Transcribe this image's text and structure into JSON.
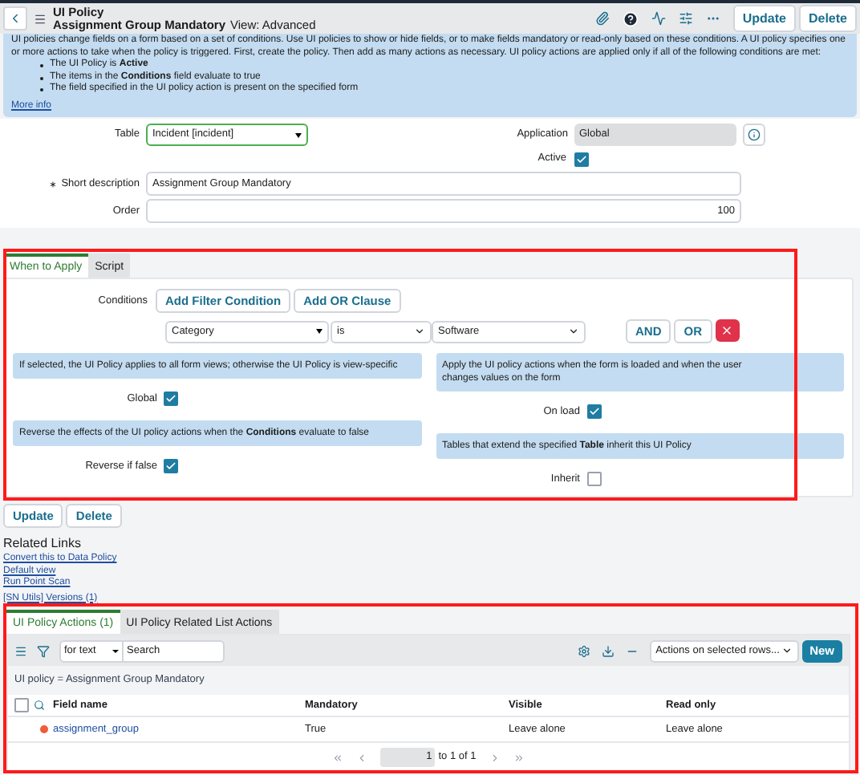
{
  "header": {
    "title": "UI Policy",
    "record": "Assignment Group Mandatory",
    "view": "View: Advanced",
    "buttons": [
      "Update",
      "Delete"
    ]
  },
  "info": {
    "intro": "UI policies change fields on a form based on a set of conditions. Use UI policies to show or hide fields, or to make fields mandatory or read-only based on these conditions. A UI policy specifies one or more actions to take when the policy is triggered. First, create the policy. Then add as many actions as necessary. UI policy actions are applied only if all of the following conditions are met:",
    "bullets": [
      "The UI Policy is **Active**",
      "The items in the **Conditions** field evaluate to true",
      "The field specified in the UI policy action is present on the specified form"
    ],
    "link": "More info"
  },
  "form": {
    "table": {
      "label": "Table",
      "value": "Incident [incident]"
    },
    "application": {
      "label": "Application",
      "value": "Global"
    },
    "active": {
      "label": "Active",
      "checked": true
    },
    "short_description": {
      "label": "Short description",
      "value": "Assignment Group Mandatory",
      "required": true
    },
    "order": {
      "label": "Order",
      "value": "100"
    }
  },
  "tabs": [
    {
      "label": "When to Apply",
      "selected": true
    },
    {
      "label": "Script",
      "selected": false
    }
  ],
  "conditions": {
    "label": "Conditions",
    "buttons": [
      "Add Filter Condition",
      "Add OR Clause"
    ],
    "field": "Category",
    "operator": "is",
    "value": "Software",
    "and": "AND",
    "or": "OR"
  },
  "options_left": [
    {
      "hint": "If selected, the UI Policy applies to all form views; otherwise the UI Policy is view-specific",
      "label": "Global",
      "checked": true
    },
    {
      "hint": "Reverse the effects of the UI policy actions when the **Conditions** evaluate to false",
      "label": "Reverse if false",
      "checked": true
    }
  ],
  "options_right": [
    {
      "hint": "Apply the UI policy actions when the form is loaded and when the user changes values on the form",
      "label": "On load",
      "checked": true
    },
    {
      "hint": "Tables that extend the specified **Table** inherit this UI Policy",
      "label": "Inherit",
      "checked": false
    }
  ],
  "form_buttons": [
    "Update",
    "Delete"
  ],
  "related_links": {
    "title": "Related Links",
    "links": [
      "Convert this to Data Policy",
      "Default view",
      "Run Point Scan",
      "[SN Utils] Versions (1)"
    ]
  },
  "related_list": {
    "tabs": [
      {
        "label": "UI Policy Actions (1)",
        "selected": true
      },
      {
        "label": "UI Policy Related List Actions",
        "selected": false
      }
    ],
    "select_all": {
      "checked": false
    },
    "search_scope": "for text",
    "search_placeholder": "Search",
    "actions": "Actions on selected rows...",
    "new": "New",
    "breadcrumb": "UI policy = Assignment Group Mandatory",
    "columns": [
      "Field name",
      "Mandatory",
      "Visible",
      "Read only"
    ],
    "rows": [
      {
        "field_name": "assignment_group",
        "mandatory": "True",
        "visible": "Leave alone",
        "read_only": "Leave alone",
        "color": "#f15a3b"
      }
    ],
    "pagination": {
      "page": "1",
      "range": "to 1 of 1"
    }
  }
}
